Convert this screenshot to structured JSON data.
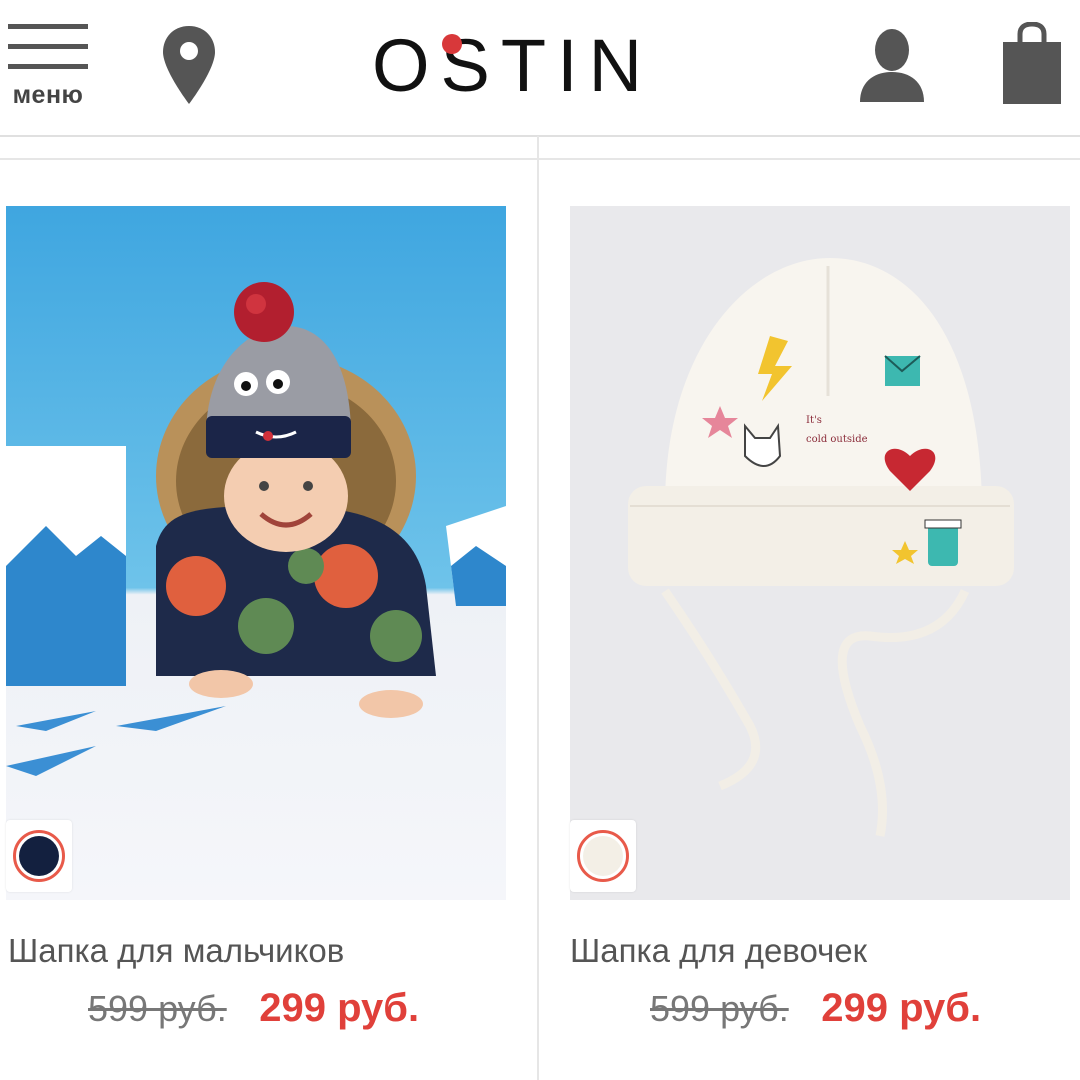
{
  "header": {
    "menu_label": "меню",
    "logo": "OSTIN",
    "logo_dot_color": "#d8383a"
  },
  "products": [
    {
      "name": "Шапка для мальчиков",
      "old_price": "599 руб.",
      "new_price": "299 руб.",
      "swatch_color": "#13203f",
      "image": "baby-in-camo-snowsuit-and-pompom-hat"
    },
    {
      "name": "Шапка для девочек",
      "old_price": "599 руб.",
      "new_price": "299 руб.",
      "swatch_color": "#f3efe6",
      "image": "white-knit-hat-with-patches"
    }
  ],
  "colors": {
    "accent_red": "#e0403a",
    "icon_gray": "#555555"
  }
}
